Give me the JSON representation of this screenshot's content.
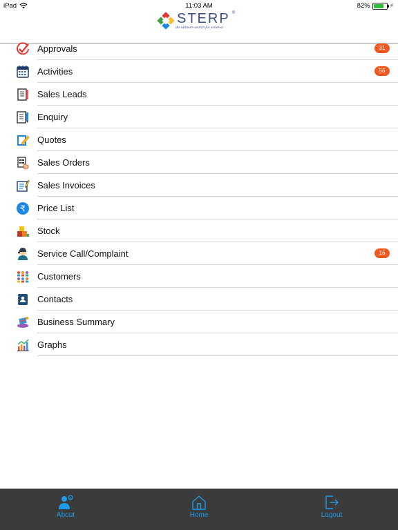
{
  "status_bar": {
    "device": "iPad",
    "time": "11:03 AM",
    "battery_percent": "82%",
    "battery_level": 0.82
  },
  "header": {
    "logo_text": "STERP",
    "logo_reg": "®",
    "logo_tagline": "the ultimate search for solution"
  },
  "menu": {
    "items": [
      {
        "label": "Approvals",
        "icon": "approvals-check-icon",
        "badge": "31"
      },
      {
        "label": "Activities",
        "icon": "calendar-icon",
        "badge": "56"
      },
      {
        "label": "Sales Leads",
        "icon": "notebook-icon",
        "badge": ""
      },
      {
        "label": "Enquiry",
        "icon": "document-pen-icon",
        "badge": ""
      },
      {
        "label": "Quotes",
        "icon": "quote-pencil-icon",
        "badge": ""
      },
      {
        "label": "Sales Orders",
        "icon": "order-hand-icon",
        "badge": ""
      },
      {
        "label": "Sales Invoices",
        "icon": "invoice-icon",
        "badge": ""
      },
      {
        "label": "Price List",
        "icon": "rupee-icon",
        "badge": ""
      },
      {
        "label": "Stock",
        "icon": "stock-boxes-icon",
        "badge": ""
      },
      {
        "label": "Service Call/Complaint",
        "icon": "support-agent-icon",
        "badge": "16"
      },
      {
        "label": "Customers",
        "icon": "people-group-icon",
        "badge": ""
      },
      {
        "label": "Contacts",
        "icon": "contact-book-icon",
        "badge": ""
      },
      {
        "label": "Business Summary",
        "icon": "business-summary-icon",
        "badge": ""
      },
      {
        "label": "Graphs",
        "icon": "bar-graph-icon",
        "badge": ""
      }
    ]
  },
  "tab_bar": {
    "about": "About",
    "home": "Home",
    "logout": "Logout"
  },
  "colors": {
    "accent_blue": "#1e9be8",
    "badge_orange": "#f05a22",
    "tab_bar_bg": "#3b3b3b",
    "logo_navy": "#3d4f87"
  }
}
